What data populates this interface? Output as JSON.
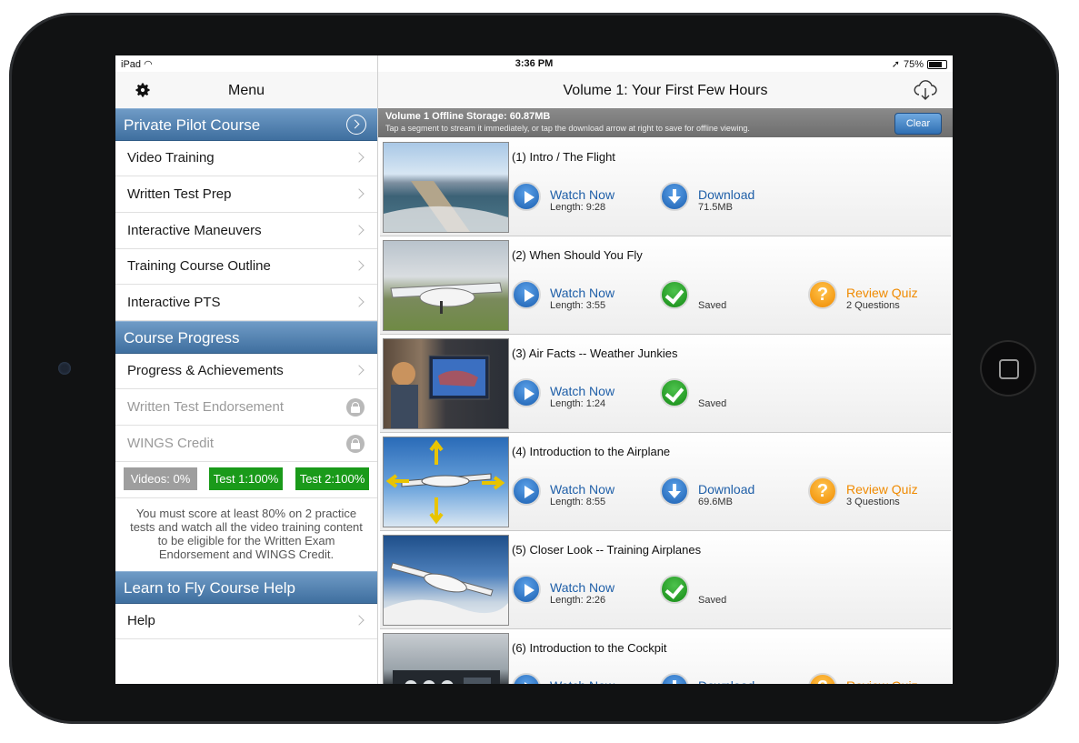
{
  "statusbar": {
    "device": "iPad",
    "time": "3:36 PM",
    "battery": "75%"
  },
  "sidebar": {
    "title": "Menu",
    "sections": [
      {
        "title": "Private Pilot Course",
        "items": [
          {
            "label": "Video Training"
          },
          {
            "label": "Written Test Prep"
          },
          {
            "label": "Interactive Maneuvers"
          },
          {
            "label": "Training Course Outline"
          },
          {
            "label": "Interactive PTS"
          }
        ]
      },
      {
        "title": "Course Progress",
        "items": [
          {
            "label": "Progress & Achievements"
          },
          {
            "label": "Written Test Endorsement"
          },
          {
            "label": "WINGS Credit"
          }
        ]
      },
      {
        "title": "Learn to Fly Course Help",
        "items": [
          {
            "label": "Help"
          }
        ]
      }
    ],
    "progress": {
      "videos": "Videos:  0%",
      "test1": "Test 1:100%",
      "test2": "Test 2:100%"
    },
    "note": "You must score at least 80% on 2 practice tests and watch all the video training content to be eligible for the Written Exam Endorsement and WINGS Credit.",
    "colors": {
      "section_bar": "#4f7fae",
      "badge_gray": "#9e9e9e",
      "badge_green": "#1a9a1a"
    }
  },
  "main": {
    "title": "Volume 1: Your First Few Hours",
    "storage_title": "Volume 1 Offline Storage: 60.87MB",
    "storage_sub": "Tap a segment to stream it immediately, or tap the download arrow at right to save for offline viewing.",
    "clear_label": "Clear",
    "watch_label": "Watch Now",
    "download_label": "Download",
    "saved_label": "Saved",
    "quiz_label": "Review Quiz",
    "segments": [
      {
        "title": "(1) Intro /  The Flight",
        "length": "Length: 9:28",
        "status": "Download",
        "size": "71.5MB",
        "quiz": ""
      },
      {
        "title": "(2) When Should You Fly",
        "length": "Length: 3:55",
        "status": "Saved",
        "size": "",
        "quiz": "2 Questions"
      },
      {
        "title": "(3) Air Facts -- Weather Junkies",
        "length": "Length: 1:24",
        "status": "Saved",
        "size": "",
        "quiz": ""
      },
      {
        "title": "(4) Introduction to the Airplane",
        "length": "Length: 8:55",
        "status": "Download",
        "size": "69.6MB",
        "quiz": "3 Questions"
      },
      {
        "title": "(5) Closer Look -- Training Airplanes",
        "length": "Length: 2:26",
        "status": "Saved",
        "size": "",
        "quiz": ""
      },
      {
        "title": "(6) Introduction to the Cockpit",
        "length": "",
        "status": "Download",
        "size": "",
        "quiz": ""
      }
    ]
  }
}
